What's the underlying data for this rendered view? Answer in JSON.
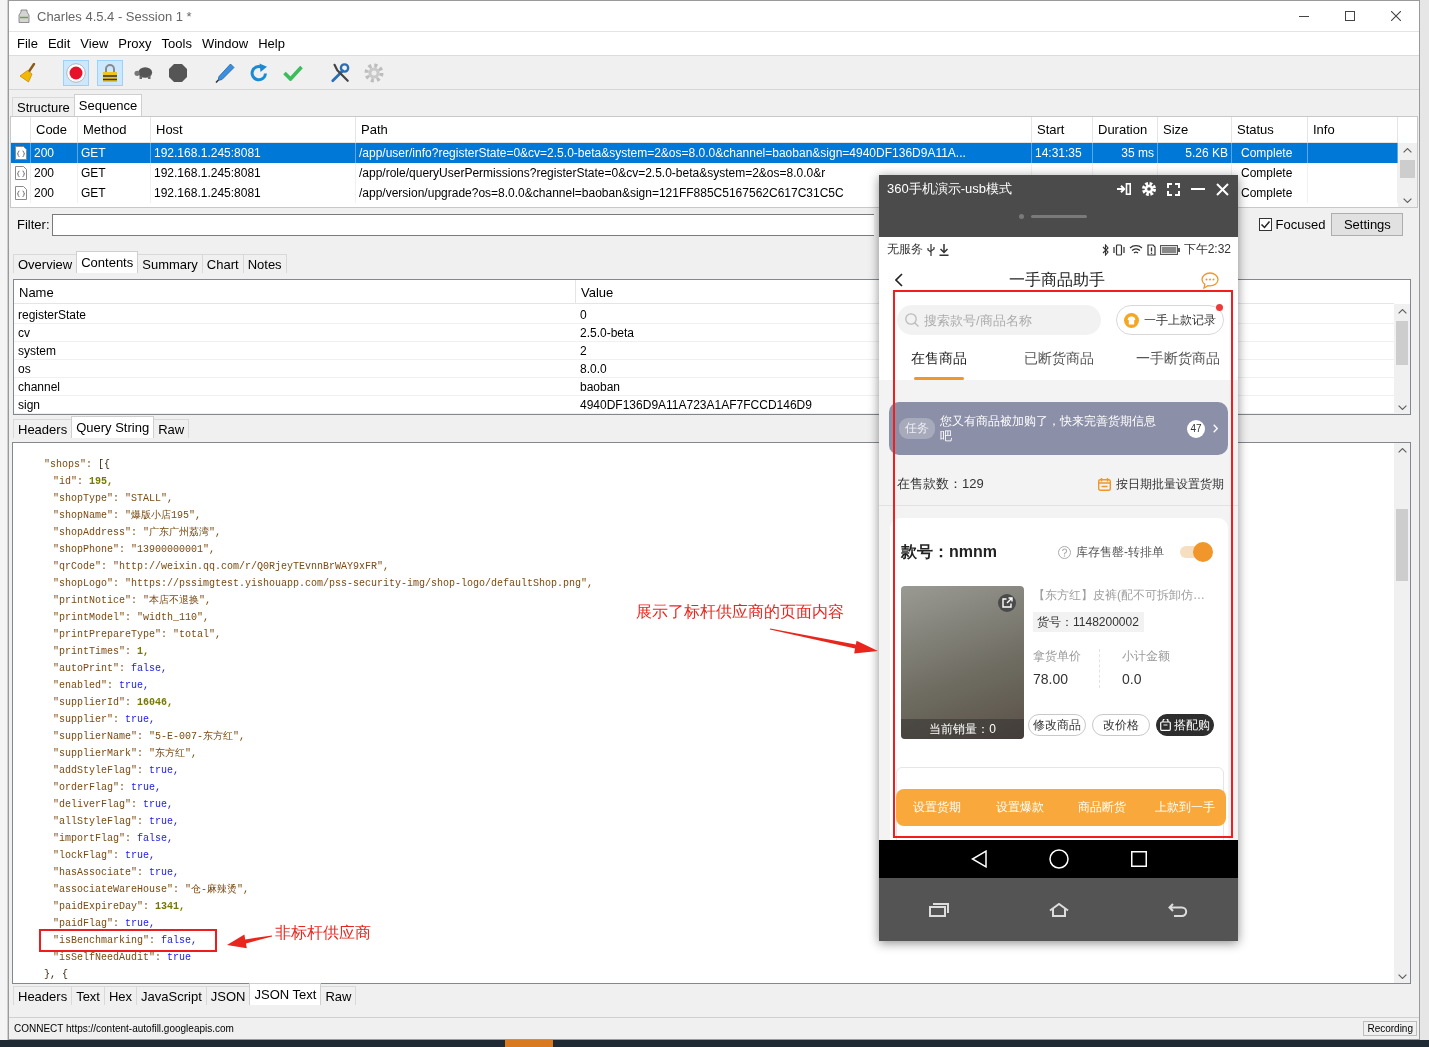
{
  "window": {
    "title": "Charles 4.5.4 - Session 1 *"
  },
  "menu": [
    "File",
    "Edit",
    "View",
    "Proxy",
    "Tools",
    "Window",
    "Help"
  ],
  "toolbar": {
    "groups": [
      {
        "items": [
          {
            "kind": "broom",
            "pressed": false
          }
        ]
      },
      {
        "items": [
          {
            "kind": "record",
            "pressed": true
          },
          {
            "kind": "padlock",
            "pressed": true
          },
          {
            "kind": "turtle",
            "pressed": false
          },
          {
            "kind": "stop",
            "pressed": false
          }
        ]
      },
      {
        "items": [
          {
            "kind": "pen",
            "pressed": false
          },
          {
            "kind": "refresh",
            "pressed": false
          },
          {
            "kind": "check",
            "pressed": false
          }
        ]
      },
      {
        "items": [
          {
            "kind": "tools",
            "pressed": false
          },
          {
            "kind": "gear",
            "pressed": false
          }
        ]
      }
    ]
  },
  "session_tabs": [
    {
      "label": "Structure",
      "selected": false
    },
    {
      "label": "Sequence",
      "selected": true
    }
  ],
  "requests": {
    "columns": [
      "Code",
      "Method",
      "Host",
      "Path",
      "Start",
      "Duration",
      "Size",
      "Status",
      "Info"
    ],
    "rows": [
      {
        "selected": true,
        "code": "200",
        "method": "GET",
        "host": "192.168.1.245:8081",
        "path": "/app/user/info?registerState=0&cv=2.5.0-beta&system=2&os=8.0.0&channel=baoban&sign=4940DF136D9A11A...",
        "start": "14:31:35",
        "duration": "35 ms",
        "size": "5.26 KB",
        "status": "Complete"
      },
      {
        "selected": false,
        "code": "200",
        "method": "GET",
        "host": "192.168.1.245:8081",
        "path": "/app/role/queryUserPermissions?registerState=0&cv=2.5.0-beta&system=2&os=8.0.0&r",
        "status": "Complete"
      },
      {
        "selected": false,
        "code": "200",
        "method": "GET",
        "host": "192.168.1.245:8081",
        "path": "/app/version/upgrade?os=8.0.0&channel=baoban&sign=121FF885C5167562C617C31C5C",
        "status": "Complete"
      }
    ]
  },
  "filter": {
    "label": "Filter:",
    "focused": {
      "label": "Focused",
      "checked": true
    },
    "settings": "Settings"
  },
  "detail_tabs": [
    {
      "label": "Overview",
      "selected": false
    },
    {
      "label": "Contents",
      "selected": true
    },
    {
      "label": "Summary",
      "selected": false
    },
    {
      "label": "Chart",
      "selected": false
    },
    {
      "label": "Notes",
      "selected": false
    }
  ],
  "query_params": {
    "columns": [
      "Name",
      "Value"
    ],
    "rows": [
      {
        "name": "registerState",
        "value": "0"
      },
      {
        "name": "cv",
        "value": "2.5.0-beta"
      },
      {
        "name": "system",
        "value": "2"
      },
      {
        "name": "os",
        "value": "8.0.0"
      },
      {
        "name": "channel",
        "value": "baoban"
      },
      {
        "name": "sign",
        "value": "4940DF136D9A11A723A1AF7FCCD146D9"
      }
    ]
  },
  "request_tabs": [
    {
      "label": "Headers",
      "selected": false
    },
    {
      "label": "Query String",
      "selected": true
    },
    {
      "label": "Raw",
      "selected": false
    }
  ],
  "response_body": {
    "lines": [
      {
        "key": "\"shops\": ",
        "value": "[{",
        "kind": "punct",
        "highlighted": false,
        "children": [
          {
            "key": "\"id\": ",
            "value": "195,",
            "kind": "number",
            "highlighted": false
          },
          {
            "key": "\"shopType\": ",
            "value": "\"STALL\",",
            "kind": "string",
            "highlighted": false
          },
          {
            "key": "\"shopName\": ",
            "value": "\"爆版小店195\",",
            "kind": "string",
            "highlighted": false
          },
          {
            "key": "\"shopAddress\": ",
            "value": "\"广东广州荔湾\",",
            "kind": "string",
            "highlighted": false
          },
          {
            "key": "\"shopPhone\": ",
            "value": "\"13900000001\",",
            "kind": "string",
            "highlighted": false
          },
          {
            "key": "\"qrCode\": ",
            "value": "\"http://weixin.qq.com/r/Q0RjeyTEvnnBrWAY9xFR\",",
            "kind": "string",
            "highlighted": false
          },
          {
            "key": "\"shopLogo\": ",
            "value": "\"https://pssimgtest.yishouapp.com/pss-security-img/shop-logo/defaultShop.png\",",
            "kind": "string",
            "highlighted": false
          },
          {
            "key": "\"printNotice\": ",
            "value": "\"本店不退换\",",
            "kind": "string",
            "highlighted": false
          },
          {
            "key": "\"printModel\": ",
            "value": "\"width_110\",",
            "kind": "string",
            "highlighted": false
          },
          {
            "key": "\"printPrepareType\": ",
            "value": "\"total\",",
            "kind": "string",
            "highlighted": false
          },
          {
            "key": "\"printTimes\": ",
            "value": "1,",
            "kind": "number",
            "highlighted": false
          },
          {
            "key": "\"autoPrint\": ",
            "value": "false,",
            "kind": "boolean",
            "highlighted": false
          },
          {
            "key": "\"enabled\": ",
            "value": "true,",
            "kind": "boolean",
            "highlighted": false
          },
          {
            "key": "\"supplierId\": ",
            "value": "16046,",
            "kind": "number",
            "highlighted": false
          },
          {
            "key": "\"supplier\": ",
            "value": "true,",
            "kind": "boolean",
            "highlighted": false
          },
          {
            "key": "\"supplierName\": ",
            "value": "\"5-E-007-东方红\",",
            "kind": "string",
            "highlighted": false
          },
          {
            "key": "\"supplierMark\": ",
            "value": "\"东方红\",",
            "kind": "string",
            "highlighted": false
          },
          {
            "key": "\"addStyleFlag\": ",
            "value": "true,",
            "kind": "boolean",
            "highlighted": false
          },
          {
            "key": "\"orderFlag\": ",
            "value": "true,",
            "kind": "boolean",
            "highlighted": false
          },
          {
            "key": "\"deliverFlag\": ",
            "value": "true,",
            "kind": "boolean",
            "highlighted": false
          },
          {
            "key": "\"allStyleFlag\": ",
            "value": "true,",
            "kind": "boolean",
            "highlighted": false
          },
          {
            "key": "\"importFlag\": ",
            "value": "false,",
            "kind": "boolean",
            "highlighted": false
          },
          {
            "key": "\"lockFlag\": ",
            "value": "true,",
            "kind": "boolean",
            "highlighted": false
          },
          {
            "key": "\"hasAssociate\": ",
            "value": "true,",
            "kind": "boolean",
            "highlighted": false
          },
          {
            "key": "\"associateWareHouse\": ",
            "value": "\"仓-麻辣烫\",",
            "kind": "string",
            "highlighted": false
          },
          {
            "key": "\"paidExpireDay\": ",
            "value": "1341,",
            "kind": "number",
            "highlighted": false
          },
          {
            "key": "\"paidFlag\": ",
            "value": "true,",
            "kind": "boolean",
            "highlighted": false
          },
          {
            "key": "\"isBenchmarking\": ",
            "value": "false,",
            "kind": "boolean",
            "highlighted": true
          },
          {
            "key": "\"isSelfNeedAudit\": ",
            "value": "true",
            "kind": "boolean",
            "highlighted": false
          }
        ]
      },
      {
        "value": "}, {",
        "kind": "punct",
        "highlighted": false
      }
    ]
  },
  "response_tabs": [
    {
      "label": "Headers",
      "selected": false
    },
    {
      "label": "Text",
      "selected": false
    },
    {
      "label": "Hex",
      "selected": false
    },
    {
      "label": "JavaScript",
      "selected": false
    },
    {
      "label": "JSON",
      "selected": false
    },
    {
      "label": "JSON Text",
      "selected": true
    },
    {
      "label": "Raw",
      "selected": false
    }
  ],
  "status_bar": {
    "message": "CONNECT https://content-autofill.googleapis.com",
    "recording": "Recording"
  },
  "phone_window": {
    "title": "360手机演示-usb模式",
    "status_bar": {
      "carrier": "无服务",
      "time": "下午2:32"
    },
    "app": {
      "title": "一手商品助手",
      "highlighted": true,
      "search": {
        "placeholder": "搜索款号/商品名称"
      },
      "record_button": {
        "label": "一手上款记录",
        "unread": true
      },
      "tabs": [
        {
          "label": "在售商品",
          "selected": true
        },
        {
          "label": "已断货商品",
          "selected": false
        },
        {
          "label": "一手断货商品",
          "selected": false
        }
      ],
      "task_banner": {
        "tag": "任务",
        "text": "您又有商品被加购了，快来完善货期信息吧",
        "count": "47"
      },
      "summary": {
        "count_label": "在售款数：129",
        "batch_action": "按日期批量设置货期"
      },
      "product": {
        "style_no": "款号：nmnm",
        "auto_switch": {
          "label": "库存售罄-转排单",
          "on": true
        },
        "sales": "当前销量：0",
        "name": "【东方红】皮裤(配不可拆卸仿…",
        "item_no": "货号：1148200002",
        "stats": [
          {
            "label": "拿货单价",
            "value": "78.00"
          },
          {
            "label": "小计金额",
            "value": "0.0"
          }
        ],
        "buttons": [
          {
            "label": "修改商品",
            "kind": "outline"
          },
          {
            "label": "改价格",
            "kind": "outline"
          },
          {
            "label": "搭配购",
            "kind": "dark"
          }
        ]
      },
      "action_bar": [
        "设置货期",
        "设置爆款",
        "商品断货",
        "上款到一手"
      ]
    }
  },
  "annotations": [
    {
      "kind": "phone",
      "text": "展示了标杆供应商的页面内容"
    },
    {
      "kind": "line",
      "text": "非标杆供应商"
    }
  ]
}
